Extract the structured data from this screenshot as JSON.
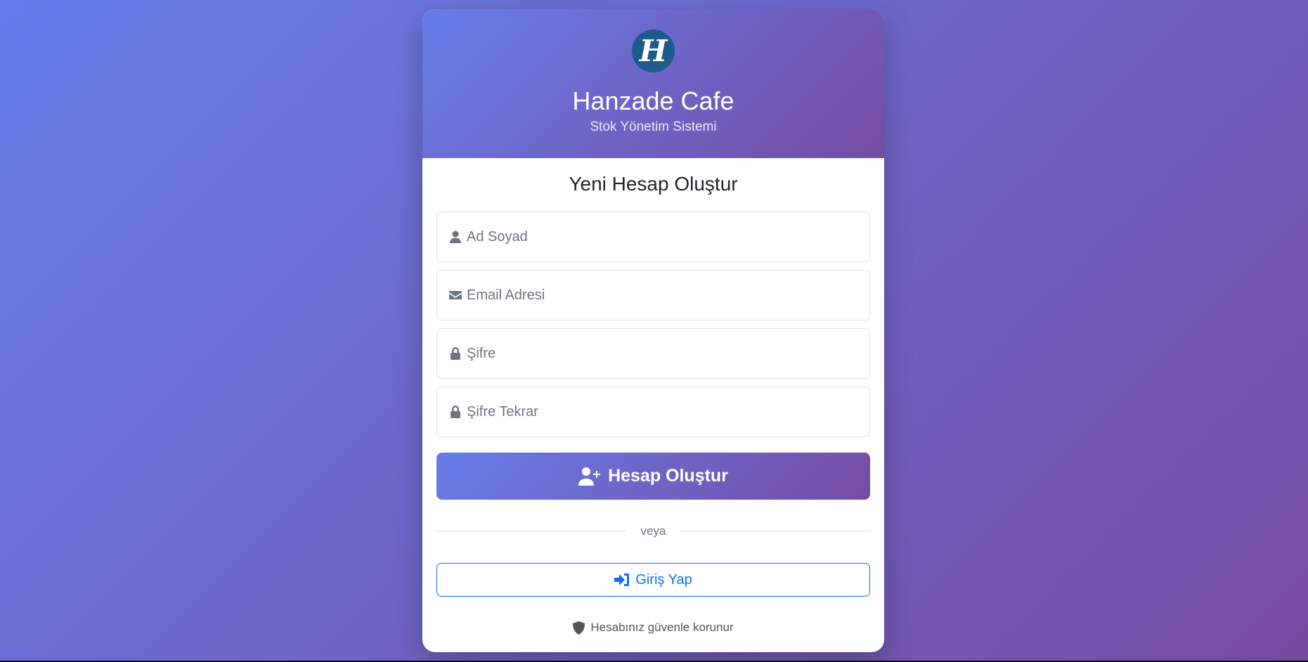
{
  "brand": {
    "logo_letter": "H",
    "title": "Hanzade Cafe",
    "subtitle": "Stok Yönetim Sistemi"
  },
  "form": {
    "heading": "Yeni Hesap Oluştur",
    "fields": [
      {
        "placeholder": "Ad Soyad",
        "icon": "user-icon",
        "value": ""
      },
      {
        "placeholder": "Email Adresi",
        "icon": "envelope-icon",
        "value": ""
      },
      {
        "placeholder": "Şifre",
        "icon": "lock-icon",
        "value": ""
      },
      {
        "placeholder": "Şifre Tekrar",
        "icon": "lock-icon",
        "value": ""
      }
    ],
    "submit_label": "Hesap Oluştur",
    "divider_text": "veya",
    "login_label": "Giriş Yap",
    "security_note": "Hesabınız güvenle korunur"
  },
  "colors": {
    "gradient_start": "#667eea",
    "gradient_end": "#764ba2",
    "link": "#0d6efd"
  }
}
